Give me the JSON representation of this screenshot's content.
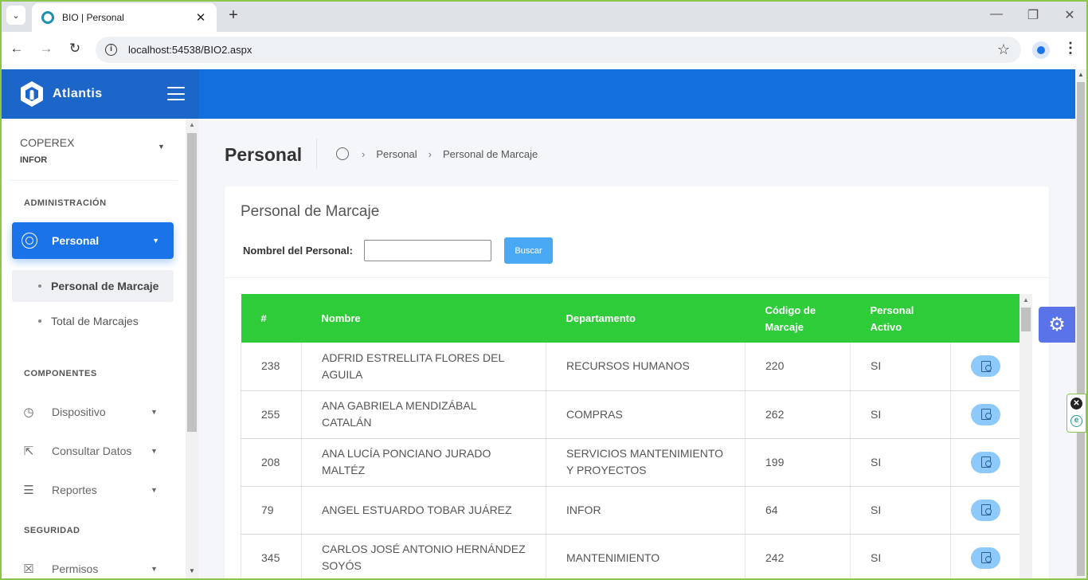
{
  "browser": {
    "tab_title": "BIO | Personal",
    "url": "localhost:54538/BIO2.aspx",
    "icons": {
      "tab_list": "chevron-down-icon",
      "new_tab": "plus-icon",
      "back": "arrow-left-icon",
      "forward": "arrow-right-icon",
      "reload": "reload-icon",
      "bookmark": "star-icon",
      "menu": "kebab-menu-icon"
    },
    "glyphs": {
      "tab_list": "⌄",
      "tab_close": "✕",
      "new_tab": "+",
      "minimize": "—",
      "restore": "❐",
      "close": "✕",
      "back": "←",
      "forward": "→",
      "reload": "↻",
      "info": "i",
      "star": "☆",
      "menu": "⋮"
    }
  },
  "app": {
    "brand": "Atlantis",
    "colors": {
      "header": "#146fde",
      "accent": "#1a73e8",
      "table_header": "#2fcc39",
      "search_button": "#4aa9f5"
    }
  },
  "sidebar": {
    "company": "COPEREX",
    "department": "INFOR",
    "sections": {
      "admin": "ADMINISTRACIÓN",
      "components": "COMPONENTES",
      "security": "SEGURIDAD"
    },
    "active_item": {
      "label": "Personal",
      "icon": "personal-icon"
    },
    "sub_items": [
      {
        "label": "Personal de Marcaje",
        "current": true
      },
      {
        "label": "Total de Marcajes",
        "current": false
      }
    ],
    "items": [
      {
        "label": "Dispositivo",
        "icon": "clock-icon",
        "glyph": "◷"
      },
      {
        "label": "Consultar Datos",
        "icon": "export-icon",
        "glyph": "⇱"
      },
      {
        "label": "Reportes",
        "icon": "report-icon",
        "glyph": "☰"
      },
      {
        "label": "Permisos",
        "icon": "permission-icon",
        "glyph": "☒"
      }
    ],
    "caret": "▼"
  },
  "page": {
    "title": "Personal",
    "breadcrumb": [
      "Personal",
      "Personal de Marcaje"
    ],
    "breadcrumb_sep": "›"
  },
  "card": {
    "title": "Personal de Marcaje",
    "search_label": "Nombrel del Personal:",
    "search_value": "",
    "search_placeholder": "",
    "search_button": "Buscar"
  },
  "table": {
    "columns": [
      "#",
      "Nombre",
      "Departamento",
      "Código de Marcaje",
      "Personal Activo",
      ""
    ],
    "rows": [
      {
        "id": "238",
        "nombre": "ADFRID ESTRELLITA FLORES DEL AGUILA",
        "departamento": "RECURSOS HUMANOS",
        "codigo": "220",
        "activo": "SI"
      },
      {
        "id": "255",
        "nombre": "ANA GABRIELA MENDIZÁBAL CATALÁN",
        "departamento": "COMPRAS",
        "codigo": "262",
        "activo": "SI"
      },
      {
        "id": "208",
        "nombre": "ANA LUCÍA PONCIANO JURADO MALTÉZ",
        "departamento": "SERVICIOS MANTENIMIENTO Y PROYECTOS",
        "codigo": "199",
        "activo": "SI"
      },
      {
        "id": "79",
        "nombre": "ANGEL ESTUARDO TOBAR JUÁREZ",
        "departamento": "INFOR",
        "codigo": "64",
        "activo": "SI"
      },
      {
        "id": "345",
        "nombre": "CARLOS JOSÉ ANTONIO HERNÁNDEZ SOYÓS",
        "departamento": "MANTENIMIENTO",
        "codigo": "242",
        "activo": "SI"
      }
    ],
    "row_action_icon": "view-document-icon"
  },
  "widgets": {
    "settings_icon": "gear-icon",
    "settings_glyph": "⚙",
    "extension_close": "✕",
    "extension_letter": "e"
  }
}
